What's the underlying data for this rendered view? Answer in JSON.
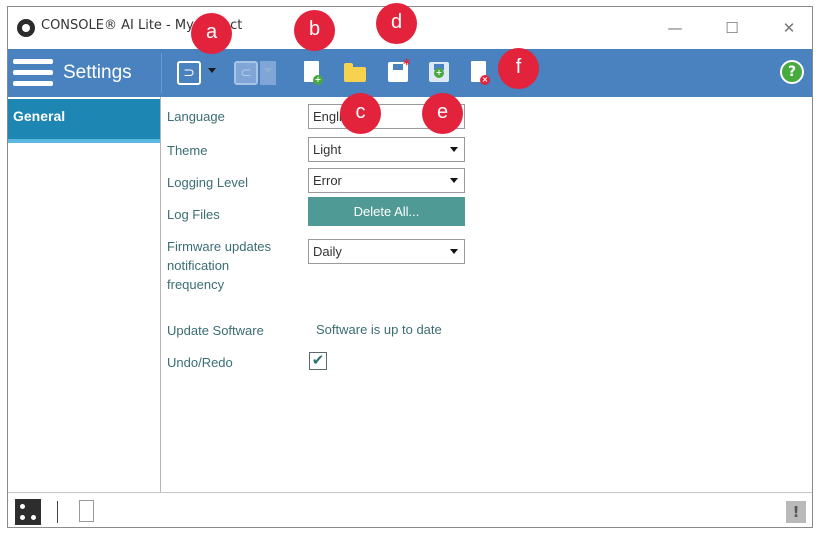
{
  "window": {
    "title": "CONSOLE® AI Lite - My Project",
    "controls": {
      "minimize": "—",
      "maximize": "☐",
      "close": "✕"
    }
  },
  "toolbar": {
    "settings_label": "Settings",
    "undo_glyph": "⊃",
    "redo_glyph": "⊂",
    "help_glyph": "?",
    "icons": [
      "new-file-icon",
      "open-folder-icon",
      "save-icon",
      "save-as-icon",
      "close-file-icon"
    ]
  },
  "sidebar": {
    "items": [
      {
        "label": "General",
        "selected": true
      }
    ]
  },
  "settings": {
    "language": {
      "label": "Language",
      "value": "English"
    },
    "theme": {
      "label": "Theme",
      "value": "Light"
    },
    "logging_level": {
      "label": "Logging Level",
      "value": "Error"
    },
    "log_files": {
      "label": "Log Files",
      "button": "Delete All..."
    },
    "firmware": {
      "label_line1": "Firmware updates",
      "label_line2": "notification",
      "label_line3": "frequency",
      "value": "Daily"
    },
    "update_software": {
      "label": "Update Software",
      "status": "Software is up to date"
    },
    "undo_redo": {
      "label": "Undo/Redo",
      "checked": true,
      "check_glyph": "✔"
    }
  },
  "statusbar": {
    "warning_glyph": "!"
  },
  "callouts": [
    "a",
    "b",
    "c",
    "d",
    "e",
    "f"
  ],
  "colors": {
    "toolbar": "#4a81bf",
    "selected_nav": "#1d86b3",
    "button": "#4f9a95",
    "callout": "#e3223b",
    "help": "#47a93e"
  }
}
